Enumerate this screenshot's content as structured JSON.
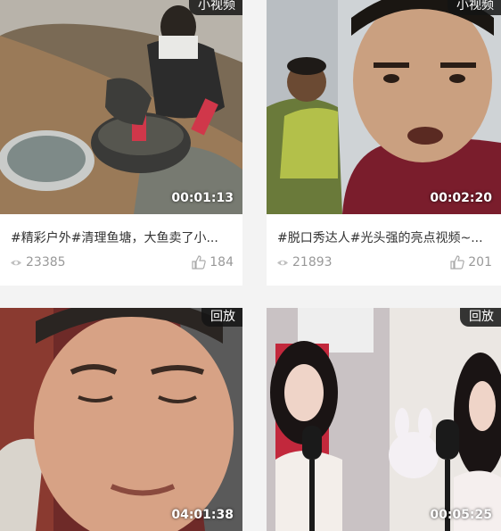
{
  "cards": [
    {
      "badge": "小视频",
      "duration": "00:01:13",
      "title": "#精彩户外#清理鱼塘，大鱼卖了小...",
      "views": "23385",
      "likes": "184"
    },
    {
      "badge": "小视频",
      "duration": "00:02:20",
      "title": "#脱口秀达人#光头强的亮点视频~...",
      "views": "21893",
      "likes": "201"
    },
    {
      "badge": "回放",
      "duration": "04:01:38"
    },
    {
      "badge": "回放",
      "duration": "00:05:25"
    }
  ]
}
